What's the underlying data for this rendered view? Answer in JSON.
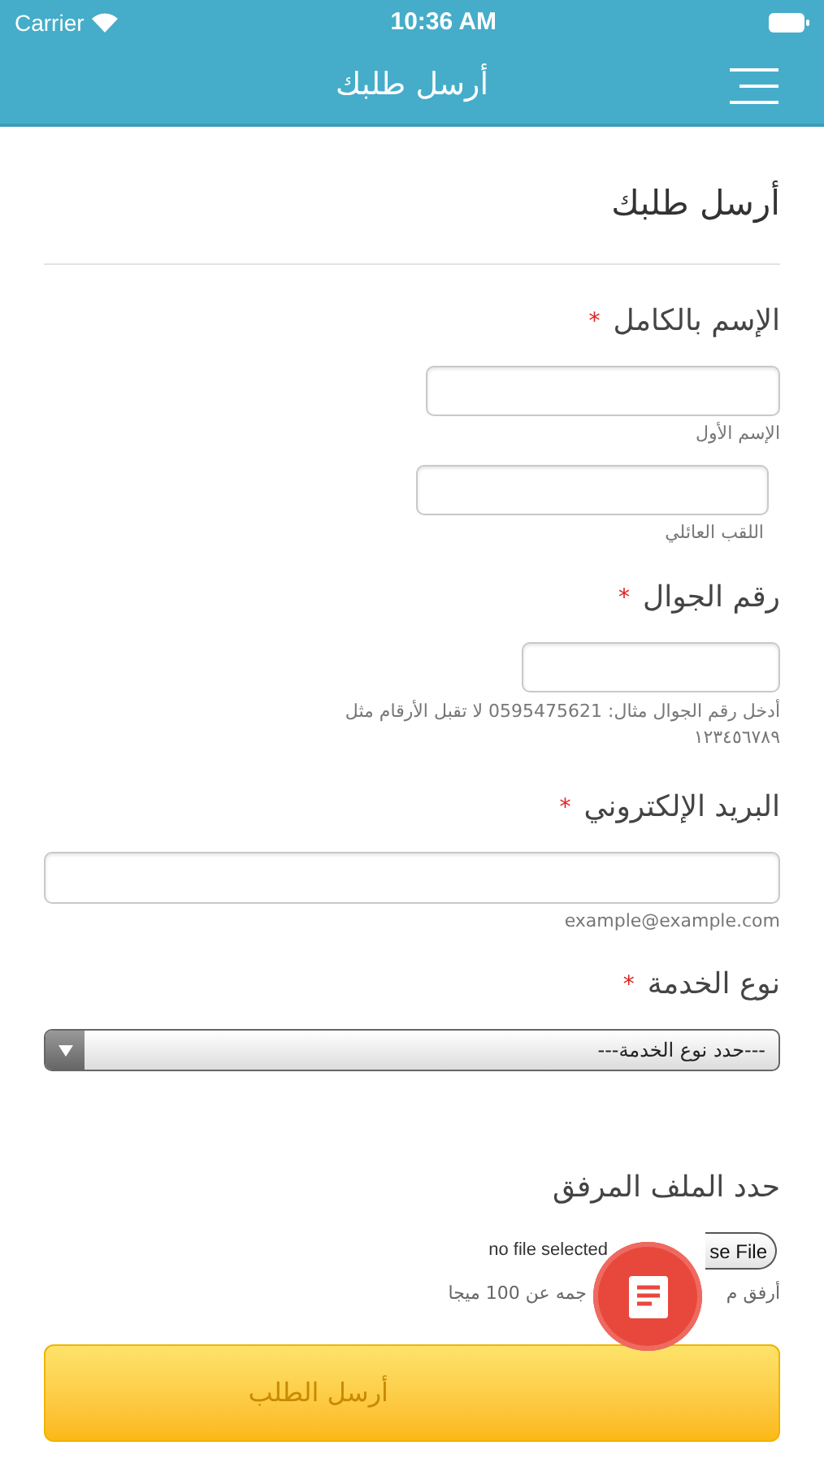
{
  "status_bar": {
    "carrier": "Carrier",
    "time": "10:36 AM"
  },
  "nav_bar": {
    "title": "أرسل طلبك"
  },
  "form": {
    "title": "أرسل طلبك",
    "fields": [
      {
        "kind": "name",
        "label": "الإسم بالكامل",
        "required_mark": "*",
        "inputs": [
          {
            "hint": "الإسم الأول"
          },
          {
            "hint": "اللقب العائلي"
          }
        ]
      },
      {
        "kind": "phone",
        "label": "رقم الجوال",
        "required_mark": "*",
        "hint_lines": [
          "أدخل رقم الجوال مثال: 0595475621 لا تقبل الأرقام مثل",
          "١٢٣٤٥٦٧٨٩"
        ]
      },
      {
        "kind": "email",
        "label": "البريد الإلكتروني",
        "required_mark": "*",
        "hint": "example@example.com"
      },
      {
        "kind": "select",
        "label": "نوع الخدمة",
        "required_mark": "*",
        "value": "---حدد نوع الخدمة---"
      },
      {
        "kind": "file",
        "label": "حدد الملف المرفق",
        "button": "se File",
        "status": "no file selected",
        "hint_parts": [
          "أرفق م",
          "جمه عن 100 ميجا"
        ]
      }
    ],
    "submit": "أرسل الطلب"
  }
}
